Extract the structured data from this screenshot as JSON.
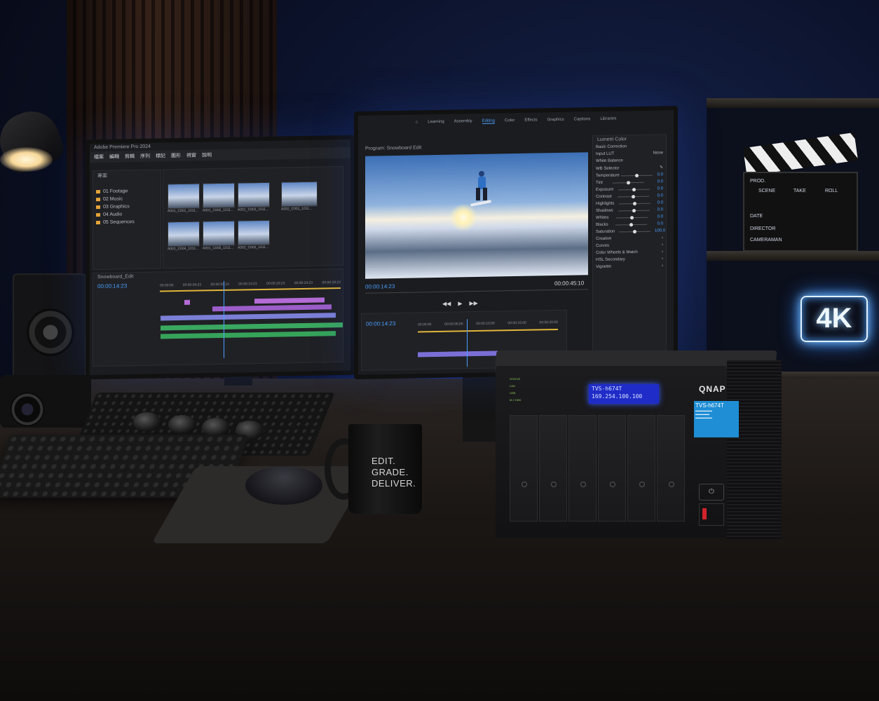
{
  "left_monitor": {
    "app_title": "Adobe Premiere Pro 2024",
    "project_panel_label": "專案",
    "bins": [
      "01 Footage",
      "02 Music",
      "03 Graphics",
      "04 Audio",
      "05 Sequences"
    ],
    "clips": [
      "A001_C001_1011...",
      "A001_C002_1011...",
      "A001_C003_1011...",
      "A002_C001_1011...",
      "A001_C004_1011...",
      "A001_C005_1011...",
      "A002_C002_1011..."
    ],
    "sequence_name": "Snowboard_Edit",
    "timecode": "00:00:14:23",
    "ruler": [
      "00:00:00",
      "00:00:04:23",
      "00:00:09:23",
      "00:00:14:23",
      "00:00:19:23",
      "00:00:24:23",
      "00:00:29:23"
    ]
  },
  "right_monitor": {
    "workspaces": [
      "Learning",
      "Assembly",
      "Editing",
      "Color",
      "Effects",
      "Graphics",
      "Captions",
      "Libraries"
    ],
    "active_workspace": "Editing",
    "program_label": "Program: Snowboard Edit",
    "current_time": "00:00:14:23",
    "duration": "00:00:45:10",
    "timeline_time": "00:00:14:23",
    "timeline_ruler": [
      "00:00:00",
      "00:00:05:00",
      "00:00:10:00",
      "00:00:15:00",
      "00:00:20:00"
    ],
    "lumetri": {
      "title": "Lumetri Color",
      "basic_correction": "Basic Correction",
      "input_lut_label": "Input LUT",
      "input_lut_value": "None",
      "white_balance": "White Balance",
      "wb_selector": "WB Selector",
      "params": [
        {
          "name": "Temperature",
          "value": "0.0"
        },
        {
          "name": "Tint",
          "value": "0.0"
        },
        {
          "name": "Exposure",
          "value": "0.0"
        },
        {
          "name": "Contrast",
          "value": "0.0"
        },
        {
          "name": "Highlights",
          "value": "0.0"
        },
        {
          "name": "Shadows",
          "value": "0.0"
        },
        {
          "name": "Whites",
          "value": "0.0"
        },
        {
          "name": "Blacks",
          "value": "0.0"
        },
        {
          "name": "Saturation",
          "value": "100.0"
        }
      ],
      "sections": [
        "Creative",
        "Curves",
        "Color Wheels & Match",
        "HSL Secondary",
        "Vignette"
      ]
    }
  },
  "mug": {
    "lines": [
      "EDIT.",
      "GRADE.",
      "DELIVER."
    ]
  },
  "nas": {
    "brand": "QNAP",
    "lcd_line1": "TVS-h674T",
    "lcd_line2": "169.254.100.100",
    "model_sticker": "TVS-h674T",
    "status_labels": [
      "STATUS",
      "LAN",
      "USB",
      "M.2 HDD"
    ],
    "bay_count": 6
  },
  "clapperboard": {
    "fields": [
      "PROD.",
      "SCENE",
      "TAKE",
      "ROLL",
      "DATE",
      "DIRECTOR",
      "CAMERAMAN"
    ]
  },
  "neon_sign": "4K",
  "colors": {
    "premiere_accent": "#4a9fff",
    "lcd_blue": "#1f2cc7",
    "neon_blue": "#3b8cff"
  }
}
